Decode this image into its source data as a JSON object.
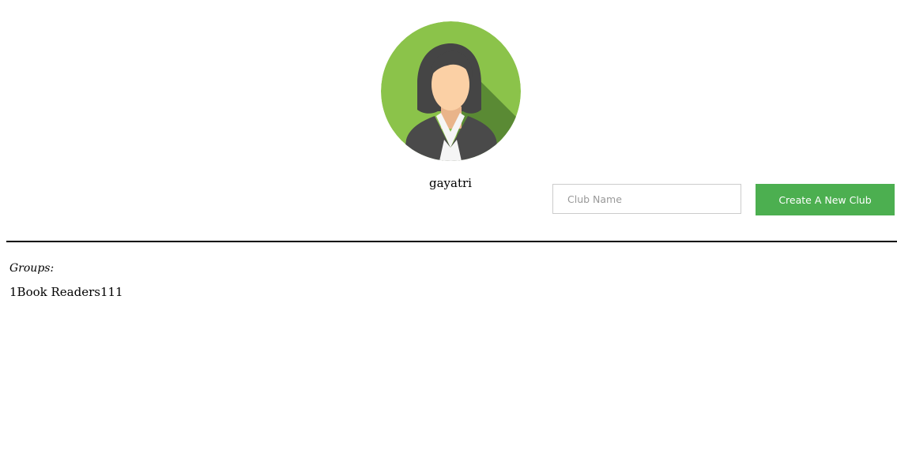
{
  "profile": {
    "username": "gayatri",
    "avatar_icon": "user-avatar-icon",
    "avatar_bg_color": "#8bc34a"
  },
  "club_form": {
    "input_value": "",
    "input_placeholder": "Club Name",
    "create_button_label": "Create A New Club",
    "button_color": "#4caf50"
  },
  "groups": {
    "label": "Groups:",
    "items": [
      {
        "name": "1Book Readers111"
      }
    ]
  }
}
